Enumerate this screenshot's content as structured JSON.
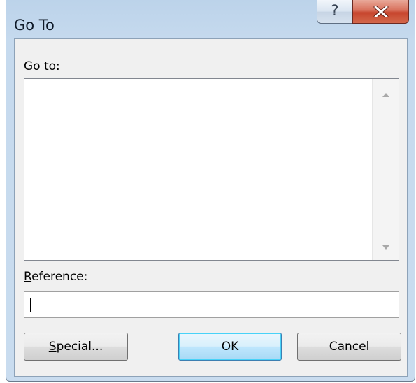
{
  "window": {
    "title": "Go To",
    "help_glyph": "?",
    "close_icon": "close-x-icon"
  },
  "goto": {
    "label": "Go to:",
    "items": []
  },
  "reference": {
    "label_accesskey": "R",
    "label_rest": "eference:",
    "value": ""
  },
  "buttons": {
    "special_accesskey": "S",
    "special_rest": "pecial...",
    "ok": "OK",
    "cancel": "Cancel"
  },
  "colors": {
    "close_button": "#c7452d",
    "default_button_border": "#3c7fb1",
    "titlebar": "#bcd3ea",
    "client_area": "#f0f0f0"
  }
}
